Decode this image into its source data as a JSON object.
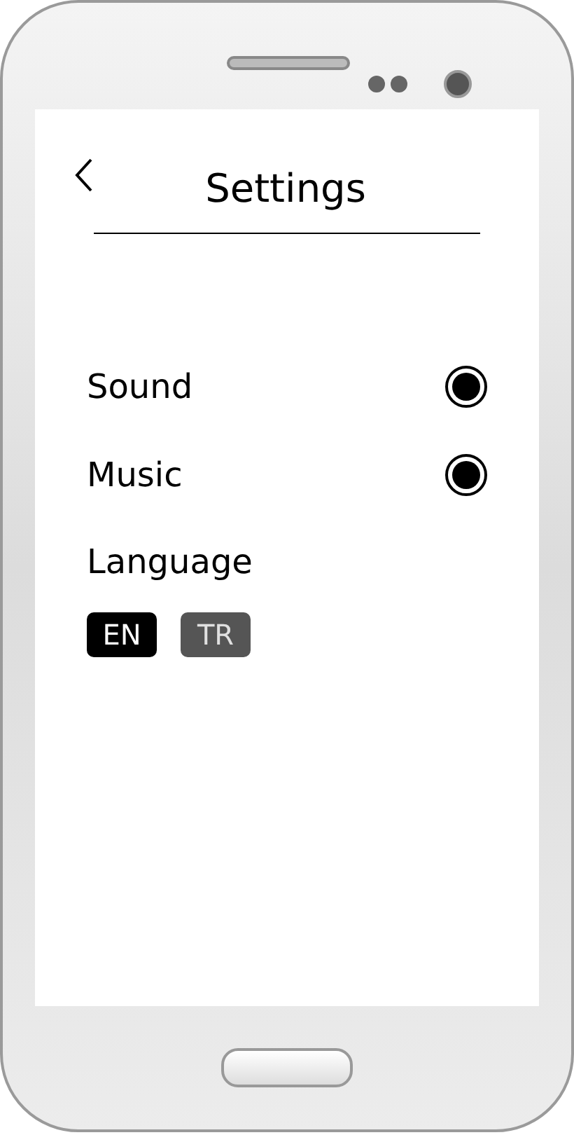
{
  "header": {
    "title": "Settings"
  },
  "options": [
    {
      "label": "Sound",
      "on": true
    },
    {
      "label": "Music",
      "on": true
    }
  ],
  "language": {
    "label": "Language",
    "choices": [
      {
        "label": "EN",
        "selected": true
      },
      {
        "label": "TR",
        "selected": false
      }
    ]
  }
}
